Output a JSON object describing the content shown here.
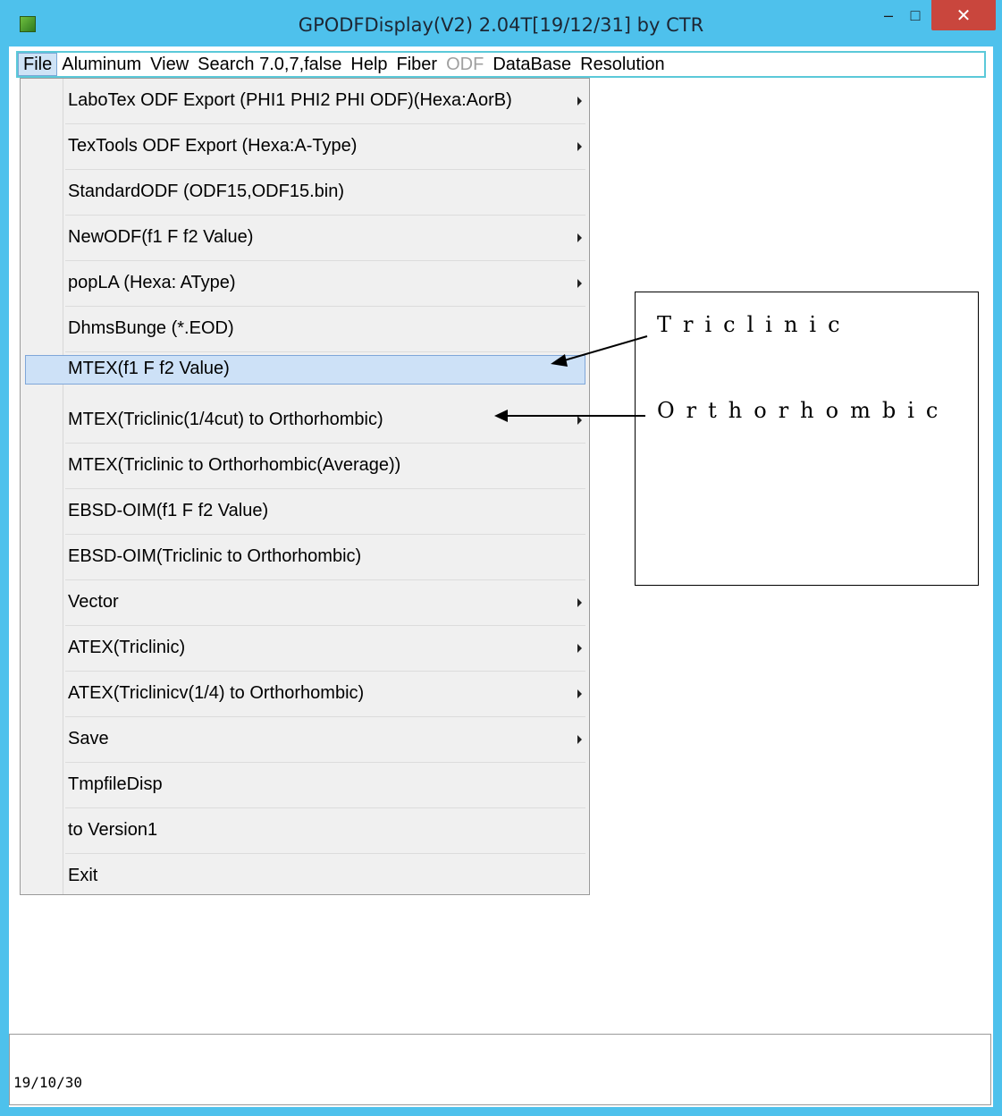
{
  "window": {
    "title": "GPODFDisplay(V2) 2.04T[19/12/31] by CTR",
    "minimize_glyph": "‒",
    "maximize_glyph": "□",
    "close_glyph": "✕"
  },
  "menubar": {
    "items": [
      {
        "label": "File",
        "state": "active"
      },
      {
        "label": "Aluminum",
        "state": "normal"
      },
      {
        "label": "View",
        "state": "normal"
      },
      {
        "label": "Search 7.0,7,false",
        "state": "normal"
      },
      {
        "label": "Help",
        "state": "normal"
      },
      {
        "label": "Fiber",
        "state": "normal"
      },
      {
        "label": "ODF",
        "state": "disabled"
      },
      {
        "label": "DataBase",
        "state": "normal"
      },
      {
        "label": "Resolution",
        "state": "normal"
      }
    ]
  },
  "file_menu": {
    "items": [
      {
        "label": "LaboTex ODF Export (PHI1 PHI2 PHI ODF)(Hexa:AorB)",
        "submenu": true
      },
      {
        "label": "TexTools ODF Export (Hexa:A-Type)",
        "submenu": true
      },
      {
        "label": "StandardODF (ODF15,ODF15.bin)",
        "submenu": false
      },
      {
        "label": "NewODF(f1 F f2 Value)",
        "submenu": true
      },
      {
        "label": "popLA (Hexa: AType)",
        "submenu": true
      },
      {
        "label": "DhmsBunge (*.EOD)",
        "submenu": false
      },
      {
        "label": "MTEX(f1 F f2 Value)",
        "submenu": false,
        "highlighted": true
      },
      {
        "label": "MTEX(Triclinic(1/4cut) to Orthorhombic)",
        "submenu": true
      },
      {
        "label": "MTEX(Triclinic to Orthorhombic(Average))",
        "submenu": false
      },
      {
        "label": "EBSD-OIM(f1 F f2 Value)",
        "submenu": false
      },
      {
        "label": "EBSD-OIM(Triclinic to Orthorhombic)",
        "submenu": false
      },
      {
        "label": "Vector",
        "submenu": true
      },
      {
        "label": "ATEX(Triclinic)",
        "submenu": true
      },
      {
        "label": "ATEX(Triclinicv(1/4) to Orthorhombic)",
        "submenu": true
      },
      {
        "label": "Save",
        "submenu": true
      },
      {
        "label": "TmpfileDisp",
        "submenu": false
      },
      {
        "label": "to Version1",
        "submenu": false
      },
      {
        "label": "Exit",
        "submenu": false
      }
    ]
  },
  "annotation": {
    "triclinic": "Triclinic",
    "orthorhombic": "Orthorhombic"
  },
  "status": {
    "text": "19/10/30"
  },
  "colors": {
    "frame": "#4ec1ec",
    "close_button": "#c9463d",
    "menu_background": "#f0f0f0",
    "highlight": "#cde1f7",
    "menubar_border": "#5bc9d9"
  }
}
